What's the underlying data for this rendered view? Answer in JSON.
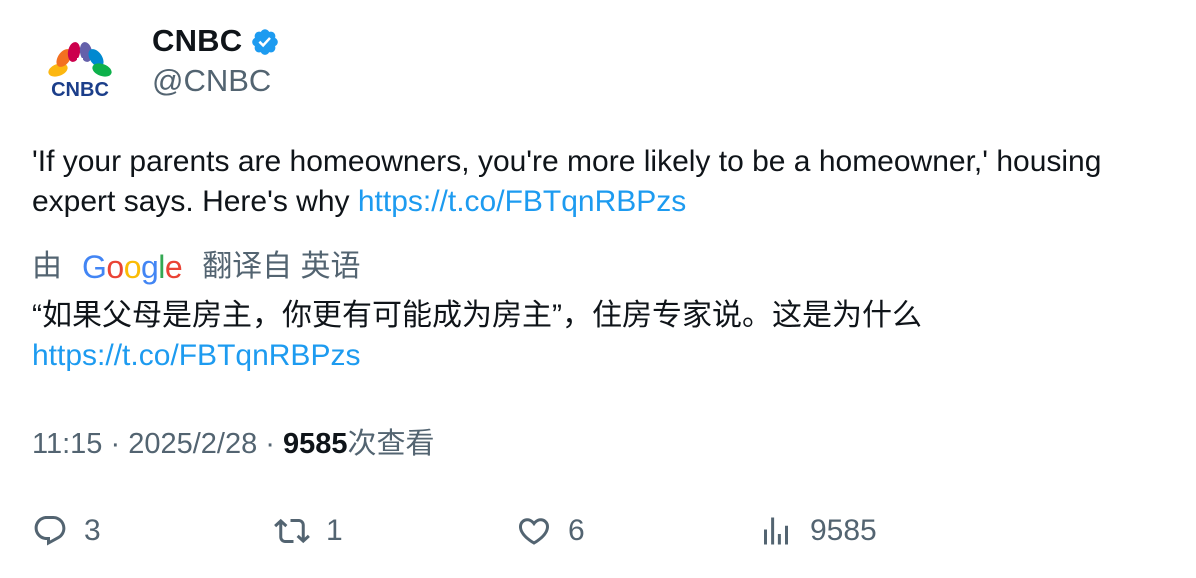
{
  "author": {
    "name": "CNBC",
    "handle": "@CNBC",
    "logo_text": "CNBC",
    "verified_color": "#1d9bf0"
  },
  "tweet": {
    "text_part1": "'If your parents are homeowners, you're more likely to be a homeowner,' housing expert says. Here's why ",
    "link": "https://t.co/FBTqnRBPzs"
  },
  "translation": {
    "prefix": "由",
    "provider": "Google",
    "suffix": "翻译自 英语",
    "text_part1": "“如果父母是房主，你更有可能成为房主”，住房专家说。这是为什么",
    "link": "https://t.co/FBTqnRBPzs"
  },
  "meta": {
    "time": "11:15",
    "sep1": " · ",
    "date": "2025/2/28",
    "sep2": " · ",
    "views": "9585",
    "views_label": "次查看"
  },
  "actions": {
    "replies": "3",
    "retweets": "1",
    "likes": "6",
    "views": "9585"
  },
  "colors": {
    "link": "#1d9bf0",
    "muted": "#536471",
    "text": "#0f1419"
  }
}
